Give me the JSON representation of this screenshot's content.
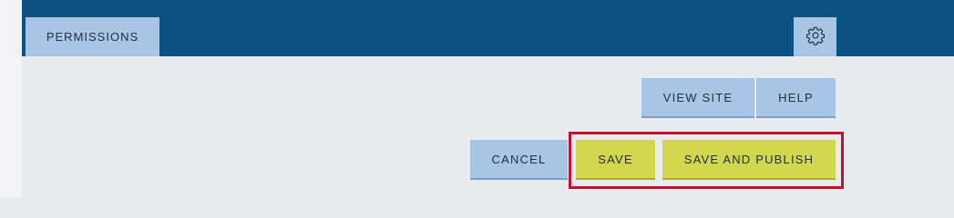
{
  "tabs": {
    "permissions_label": "PERMISSIONS",
    "settings_icon": "gear-icon"
  },
  "actions": {
    "view_site_label": "VIEW SITE",
    "help_label": "HELP",
    "cancel_label": "CANCEL",
    "save_label": "SAVE",
    "save_publish_label": "SAVE AND PUBLISH"
  },
  "colors": {
    "topbar": "#0b5283",
    "tab": "#a9c5e5",
    "primary_button": "#d3d74f",
    "highlight_border": "#c8102e",
    "background": "#e7ebf0"
  }
}
